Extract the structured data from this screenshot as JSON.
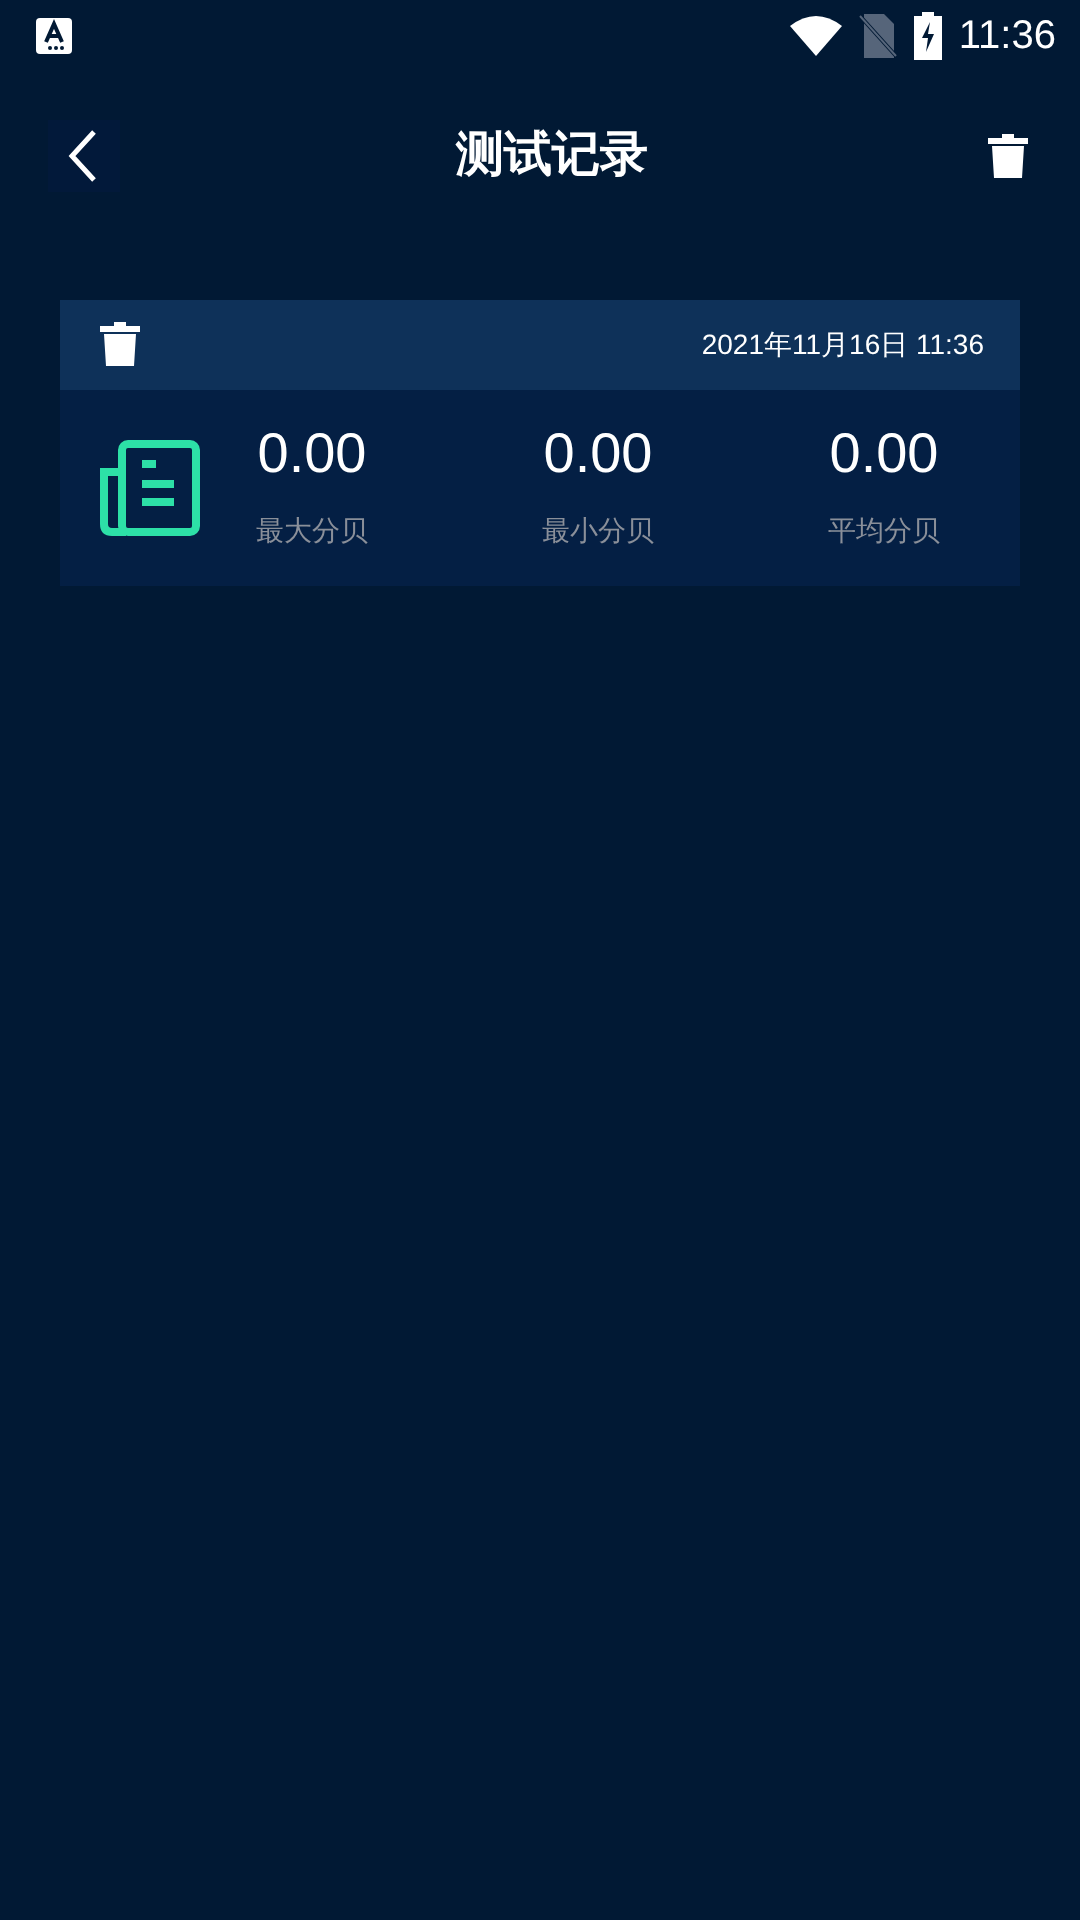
{
  "status_bar": {
    "time": "11:36"
  },
  "app_bar": {
    "title": "测试记录"
  },
  "records": [
    {
      "date": "2021年11月16日 11:36",
      "stats": [
        {
          "value": "0.00",
          "label": "最大分贝"
        },
        {
          "value": "0.00",
          "label": "最小分贝"
        },
        {
          "value": "0.00",
          "label": "平均分贝"
        }
      ]
    }
  ]
}
